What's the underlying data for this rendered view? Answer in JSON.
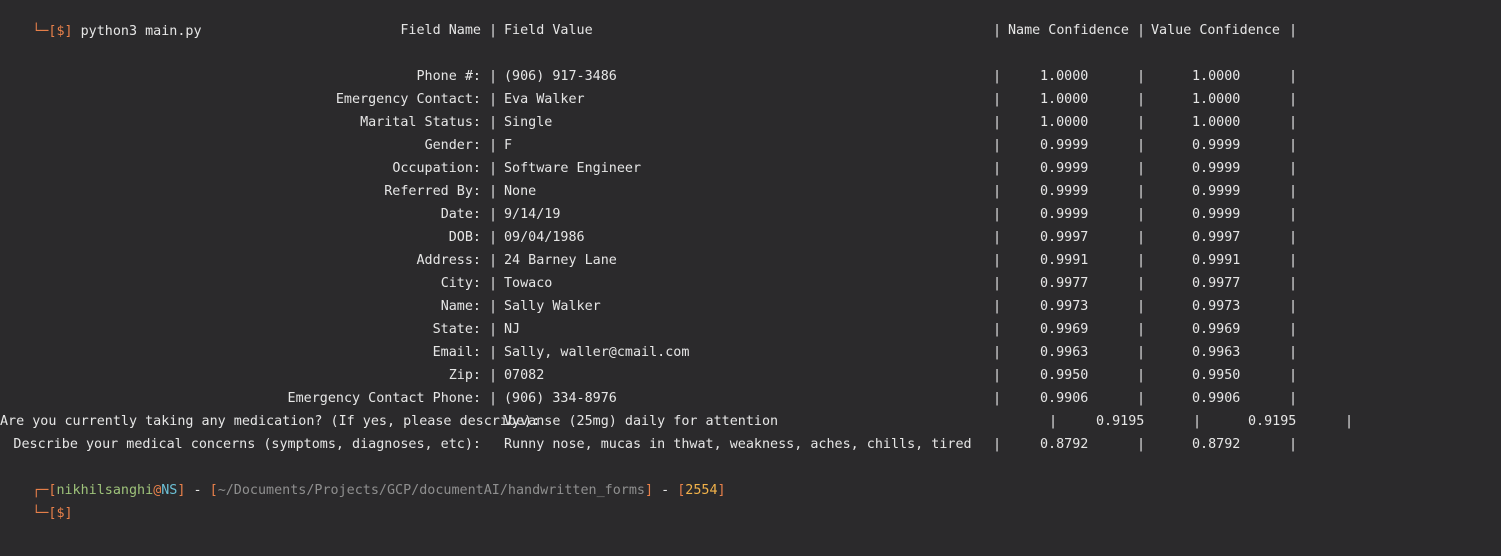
{
  "terminal": {
    "command_line": {
      "box_glyph": "└─",
      "open_bracket": "[",
      "dollar": "$",
      "close_bracket": "]",
      "command": "python3 main.py"
    },
    "header": {
      "field_name": "Field Name",
      "field_value": "Field Value",
      "name_confidence": "Name Confidence",
      "value_confidence": "Value Confidence",
      "separator": "|"
    },
    "rows": [
      {
        "name": "Phone #:",
        "value": "(906) 917-3486",
        "name_conf": "1.0000",
        "value_conf": "1.0000"
      },
      {
        "name": "Emergency Contact:",
        "value": "Eva Walker",
        "name_conf": "1.0000",
        "value_conf": "1.0000"
      },
      {
        "name": "Marital Status:",
        "value": "Single",
        "name_conf": "1.0000",
        "value_conf": "1.0000"
      },
      {
        "name": "Gender:",
        "value": "F",
        "name_conf": "0.9999",
        "value_conf": "0.9999"
      },
      {
        "name": "Occupation:",
        "value": "Software Engineer",
        "name_conf": "0.9999",
        "value_conf": "0.9999"
      },
      {
        "name": "Referred By:",
        "value": "None",
        "name_conf": "0.9999",
        "value_conf": "0.9999"
      },
      {
        "name": "Date:",
        "value": "9/14/19",
        "name_conf": "0.9999",
        "value_conf": "0.9999"
      },
      {
        "name": "DOB:",
        "value": "09/04/1986",
        "name_conf": "0.9997",
        "value_conf": "0.9997"
      },
      {
        "name": "Address:",
        "value": "24 Barney Lane",
        "name_conf": "0.9991",
        "value_conf": "0.9991"
      },
      {
        "name": "City:",
        "value": "Towaco",
        "name_conf": "0.9977",
        "value_conf": "0.9977"
      },
      {
        "name": "Name:",
        "value": "Sally Walker",
        "name_conf": "0.9973",
        "value_conf": "0.9973"
      },
      {
        "name": "State:",
        "value": "NJ",
        "name_conf": "0.9969",
        "value_conf": "0.9969"
      },
      {
        "name": "Email:",
        "value": "Sally, waller@cmail.com",
        "name_conf": "0.9963",
        "value_conf": "0.9963"
      },
      {
        "name": "Zip:",
        "value": "07082",
        "name_conf": "0.9950",
        "value_conf": "0.9950"
      },
      {
        "name": "Emergency Contact Phone:",
        "value": "(906) 334-8976",
        "name_conf": "0.9906",
        "value_conf": "0.9906"
      }
    ],
    "medication_row": {
      "name": "Are you currently taking any medication? (If yes, please describe):",
      "value": "Vyvanse (25mg) daily for attention",
      "name_conf": "0.9195",
      "value_conf": "0.9195"
    },
    "concerns_row": {
      "name": "Describe your medical concerns (symptoms, diagnoses, etc):",
      "value": "Runny nose, mucas in thwat, weakness, aches, chills, tired",
      "name_conf": "0.8792",
      "value_conf": "0.8792"
    },
    "prompt": {
      "box_top": "┌─",
      "box_bottom": "└─",
      "open_bracket": "[",
      "close_bracket": "]",
      "user": "nikhilsanghi",
      "at": "@",
      "host": "NS",
      "dash": " - ",
      "path": "~/Documents/Projects/GCP/documentAI/handwritten_forms",
      "number": "2554",
      "dollar": "$"
    },
    "colors": {
      "background": "#2b2a2c",
      "text": "#e6e6e6",
      "bracket": "#e8804a",
      "user": "#9ec27a",
      "host": "#6cc0d6",
      "path": "#8f8f8f",
      "number": "#f2b24a"
    }
  }
}
